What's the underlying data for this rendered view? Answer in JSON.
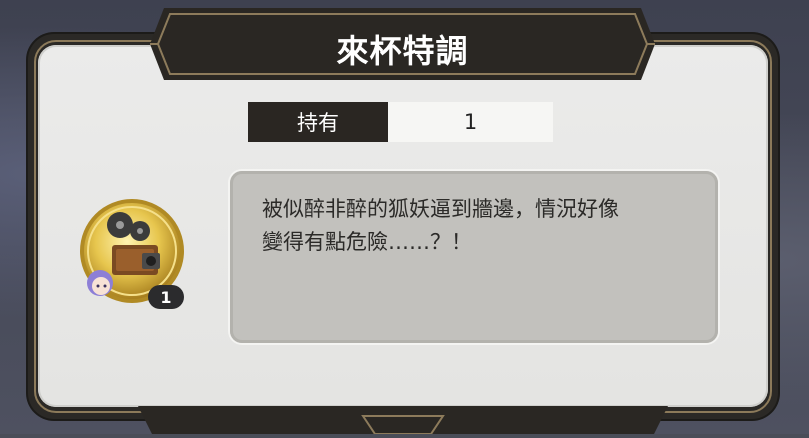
{
  "dialog": {
    "title": "來杯特調",
    "owned_label": "持有",
    "owned_value": "1",
    "description_line1": "被似醉非醉的狐妖逼到牆邊，情況好像",
    "description_line2": "變得有點危險……？！",
    "item_count": "1",
    "item_icon": "film-projector-icon"
  },
  "colors": {
    "frame": "#2b2926",
    "panel": "#ebebea",
    "desc_box": "#c2c1bd",
    "gold": "#d9b846"
  }
}
